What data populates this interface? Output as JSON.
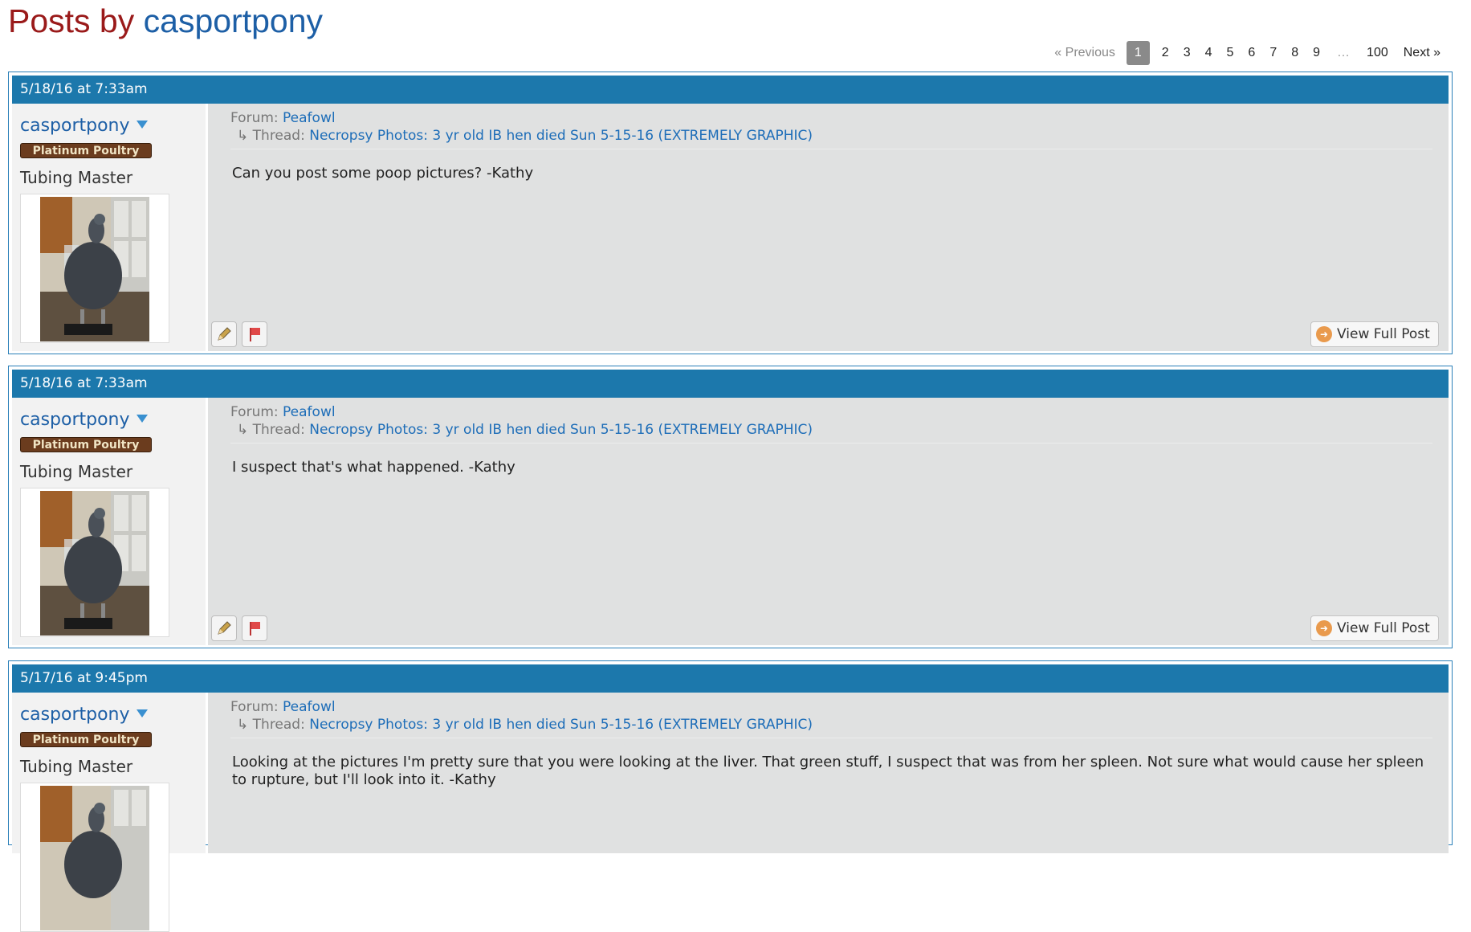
{
  "header": {
    "title_prefix": "Posts by",
    "title_user": "casportpony"
  },
  "pagination": {
    "prev": "« Previous",
    "current": "1",
    "pages": [
      "2",
      "3",
      "4",
      "5",
      "6",
      "7",
      "8",
      "9"
    ],
    "ellipsis": "…",
    "last": "100",
    "next": "Next »"
  },
  "author": {
    "name": "casportpony",
    "badge": "Platinum Poultry",
    "role": "Tubing Master"
  },
  "labels": {
    "forum": "Forum:",
    "thread": "Thread:",
    "view_full_post": "View Full Post"
  },
  "posts": [
    {
      "date": "5/18/16 at 7:33am",
      "forum": "Peafowl",
      "thread": "Necropsy Photos: 3 yr old IB hen died Sun 5-15-16 (EXTREMELY GRAPHIC)",
      "content": "Can you post some poop pictures? -Kathy"
    },
    {
      "date": "5/18/16 at 7:33am",
      "forum": "Peafowl",
      "thread": "Necropsy Photos: 3 yr old IB hen died Sun 5-15-16 (EXTREMELY GRAPHIC)",
      "content": "I suspect that's what happened. -Kathy"
    },
    {
      "date": "5/17/16 at 9:45pm",
      "forum": "Peafowl",
      "thread": "Necropsy Photos: 3 yr old IB hen died Sun 5-15-16 (EXTREMELY GRAPHIC)",
      "content": "Looking at the pictures I'm pretty sure that you were looking at the liver. That green stuff, I suspect that was from her spleen. Not sure what would cause her spleen to rupture, but I'll look into it.   -Kathy"
    }
  ],
  "colors": {
    "header_bar": "#1c78ac",
    "link": "#1d6db8",
    "title_red": "#9a1a1a",
    "badge_bg": "#6b3c1e"
  }
}
